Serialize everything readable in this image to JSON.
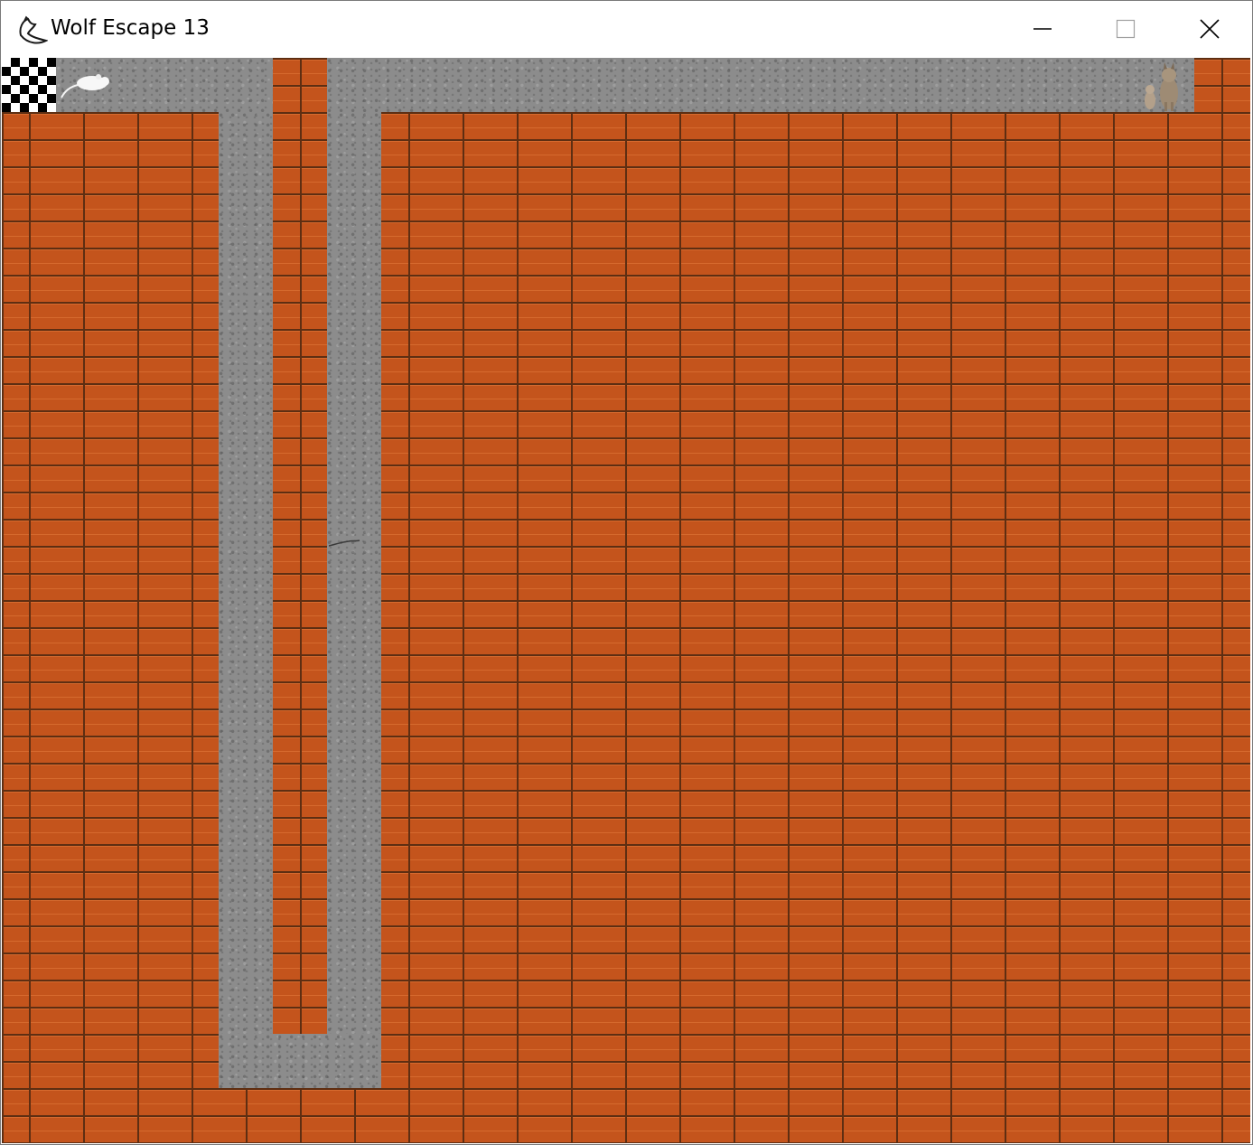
{
  "window": {
    "title": "Wolf Escape 13",
    "app_icon": "wolf-head-icon",
    "controls": [
      "minimize-icon",
      "maximize-icon",
      "close-icon"
    ]
  },
  "game": {
    "tiles": {
      "wall": "brick",
      "floor": "concrete",
      "goal": "checkered-flag"
    },
    "sprites": {
      "player": "white-mouse",
      "enemy": "wolf-pair"
    },
    "colors": {
      "brick": "#c4541c",
      "mortar": "#5e2e12",
      "floor": "#8c8c8c"
    }
  }
}
